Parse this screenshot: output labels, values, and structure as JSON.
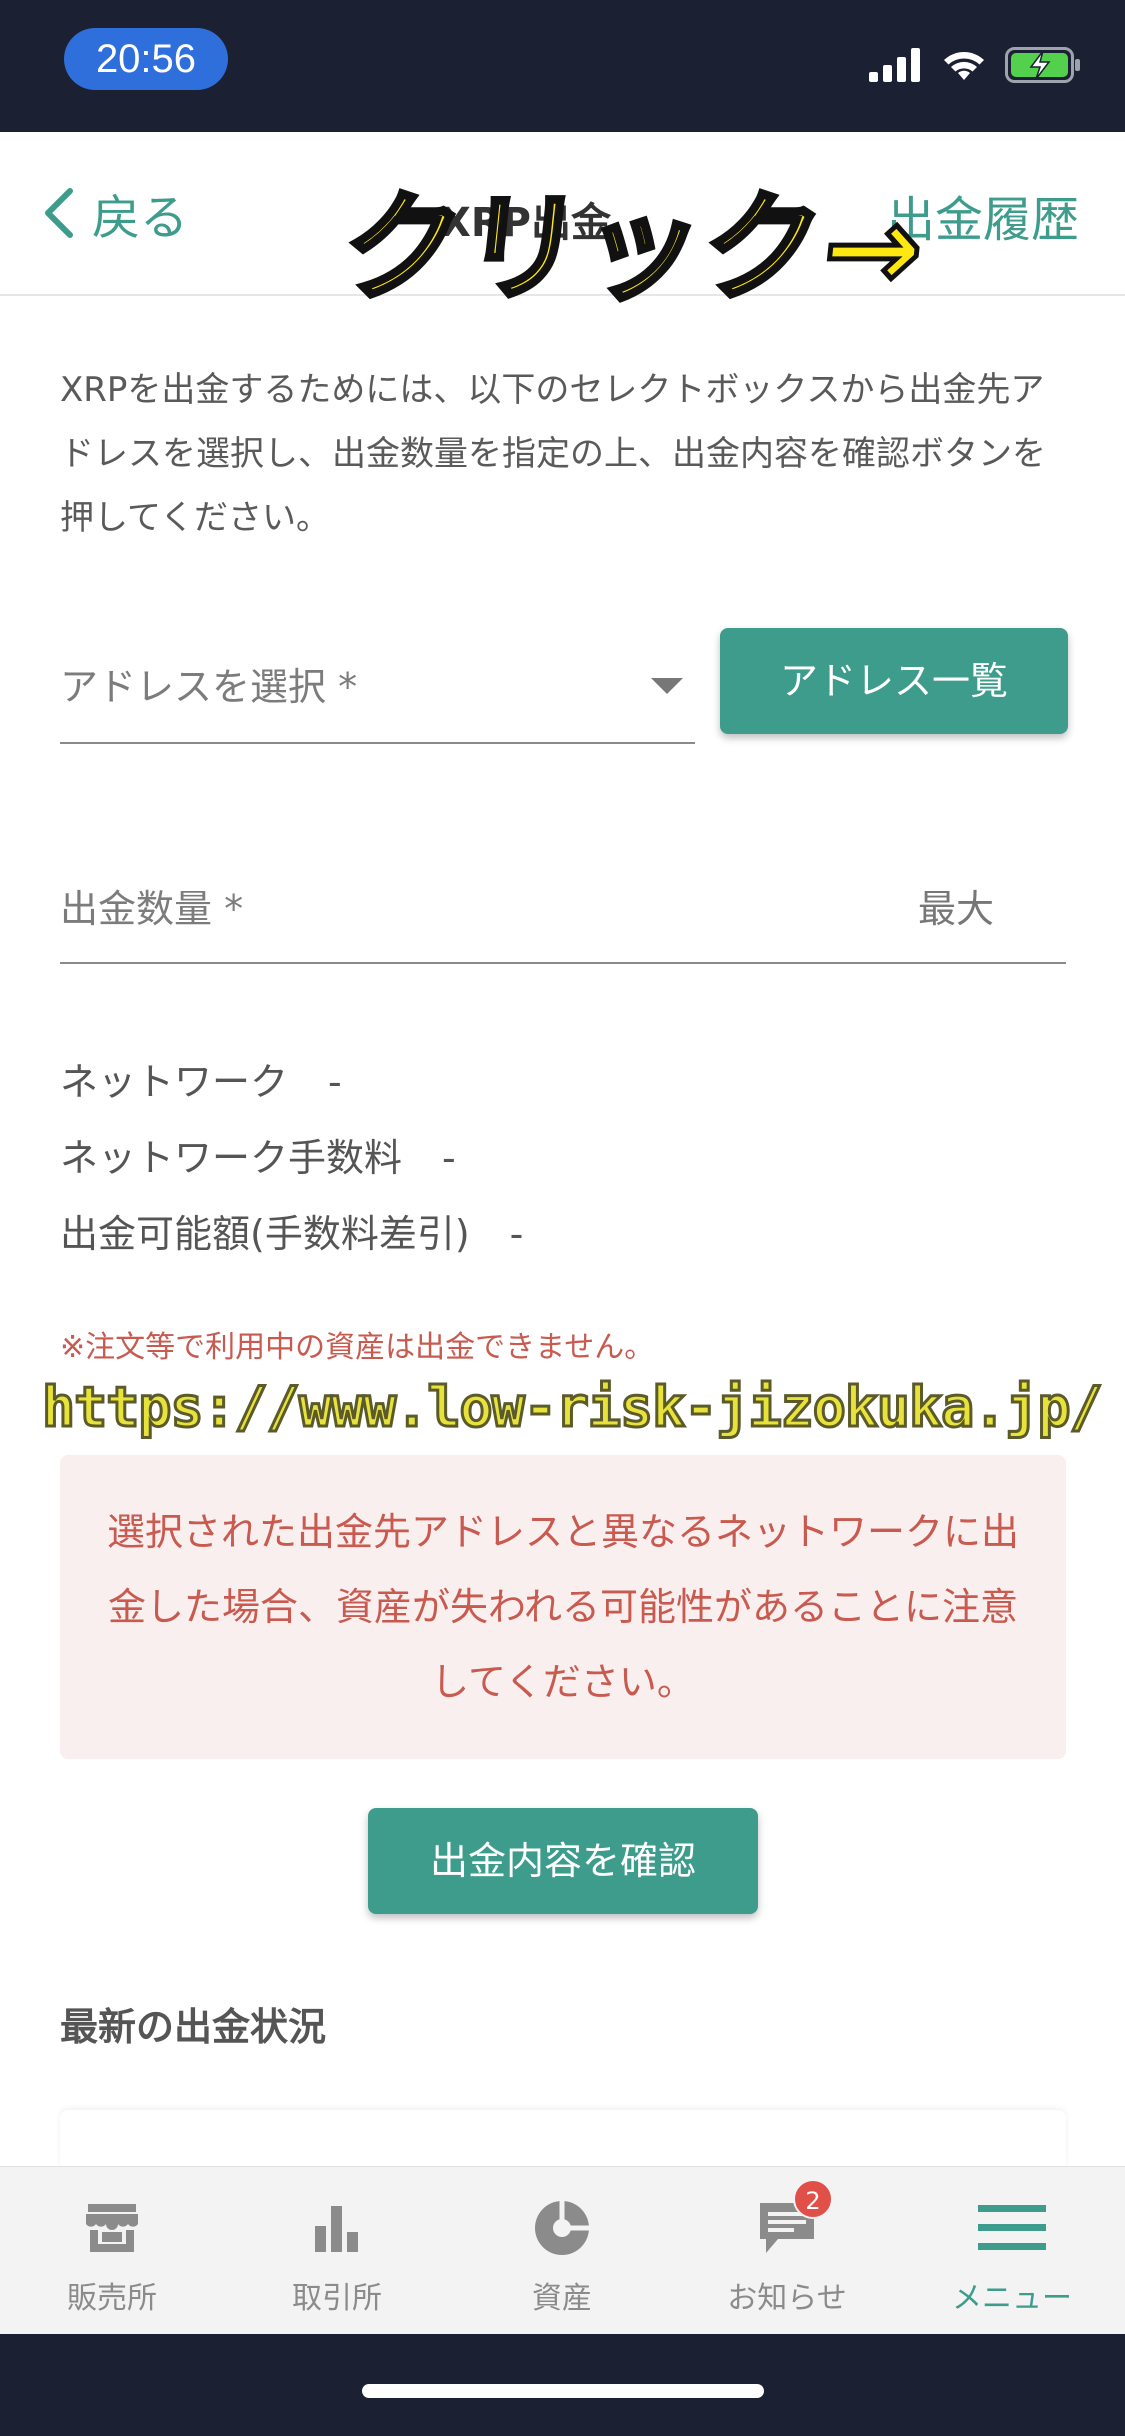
{
  "status_bar": {
    "time": "20:56"
  },
  "nav": {
    "back_label": "戻る",
    "title": "XRP出金",
    "history_label": "出金履歴"
  },
  "overlay": {
    "click_text": "クリック→",
    "url_text": "https://www.low-risk-jizokuka.jp/"
  },
  "instruction": "XRPを出金するためには、以下のセレクトボックスから出金先アドレスを選択し、出金数量を指定の上、出金内容を確認ボタンを押してください。",
  "address": {
    "label": "アドレスを選択 *",
    "list_button": "アドレス一覧"
  },
  "amount": {
    "label": "出金数量 *",
    "max_label": "最大"
  },
  "info": [
    {
      "label": "ネットワーク",
      "value": "-"
    },
    {
      "label": "ネットワーク手数料",
      "value": "-"
    },
    {
      "label": "出金可能額(手数料差引)",
      "value": "-"
    }
  ],
  "warning_small": "※注文等で利用中の資産は出金できません。",
  "alert_text": "選択された出金先アドレスと異なるネットワークに出金した場合、資産が失われる可能性があることに注意してください。",
  "confirm_button": "出金内容を確認",
  "section_title": "最新の出金状況",
  "tabs": [
    {
      "label": "販売所",
      "icon": "store-icon"
    },
    {
      "label": "取引所",
      "icon": "bar-chart-icon"
    },
    {
      "label": "資産",
      "icon": "pie-chart-icon"
    },
    {
      "label": "お知らせ",
      "icon": "message-icon",
      "badge": "2"
    },
    {
      "label": "メニュー",
      "icon": "menu-icon",
      "active": true
    }
  ],
  "colors": {
    "accent": "#3e9c8c",
    "warning": "#c85a4f",
    "alert_bg": "#f9efef",
    "status_bg": "#1b2032"
  }
}
